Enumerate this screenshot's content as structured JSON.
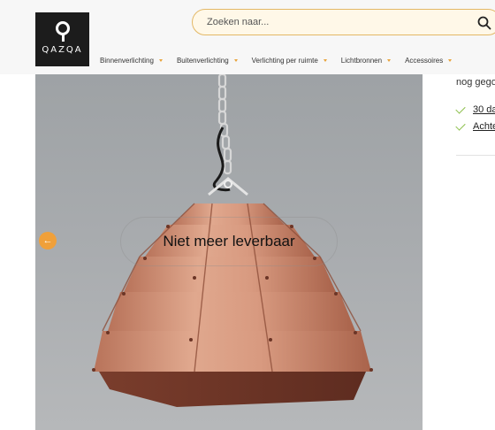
{
  "header": {
    "logo_text": "QAZQA",
    "search": {
      "placeholder": "Zoeken naar..."
    },
    "nav": [
      {
        "label": "Binnenverlichting"
      },
      {
        "label": "Buitenverlichting"
      },
      {
        "label": "Verlichting per ruimte"
      },
      {
        "label": "Lichtbronnen"
      },
      {
        "label": "Accessoires"
      }
    ]
  },
  "product": {
    "status_overlay": "Niet meer leverbaar",
    "prev_arrow": "←"
  },
  "sidebar": {
    "stock_text": "nog gego",
    "usps": [
      {
        "label": "30 da",
        "icon": "check-icon"
      },
      {
        "label": "Achte",
        "icon": "check-icon"
      }
    ]
  },
  "colors": {
    "accent": "#f0a03a",
    "check": "#8bbf4a",
    "search_border": "#e3b866",
    "logo_bg": "#1c1c1c"
  }
}
